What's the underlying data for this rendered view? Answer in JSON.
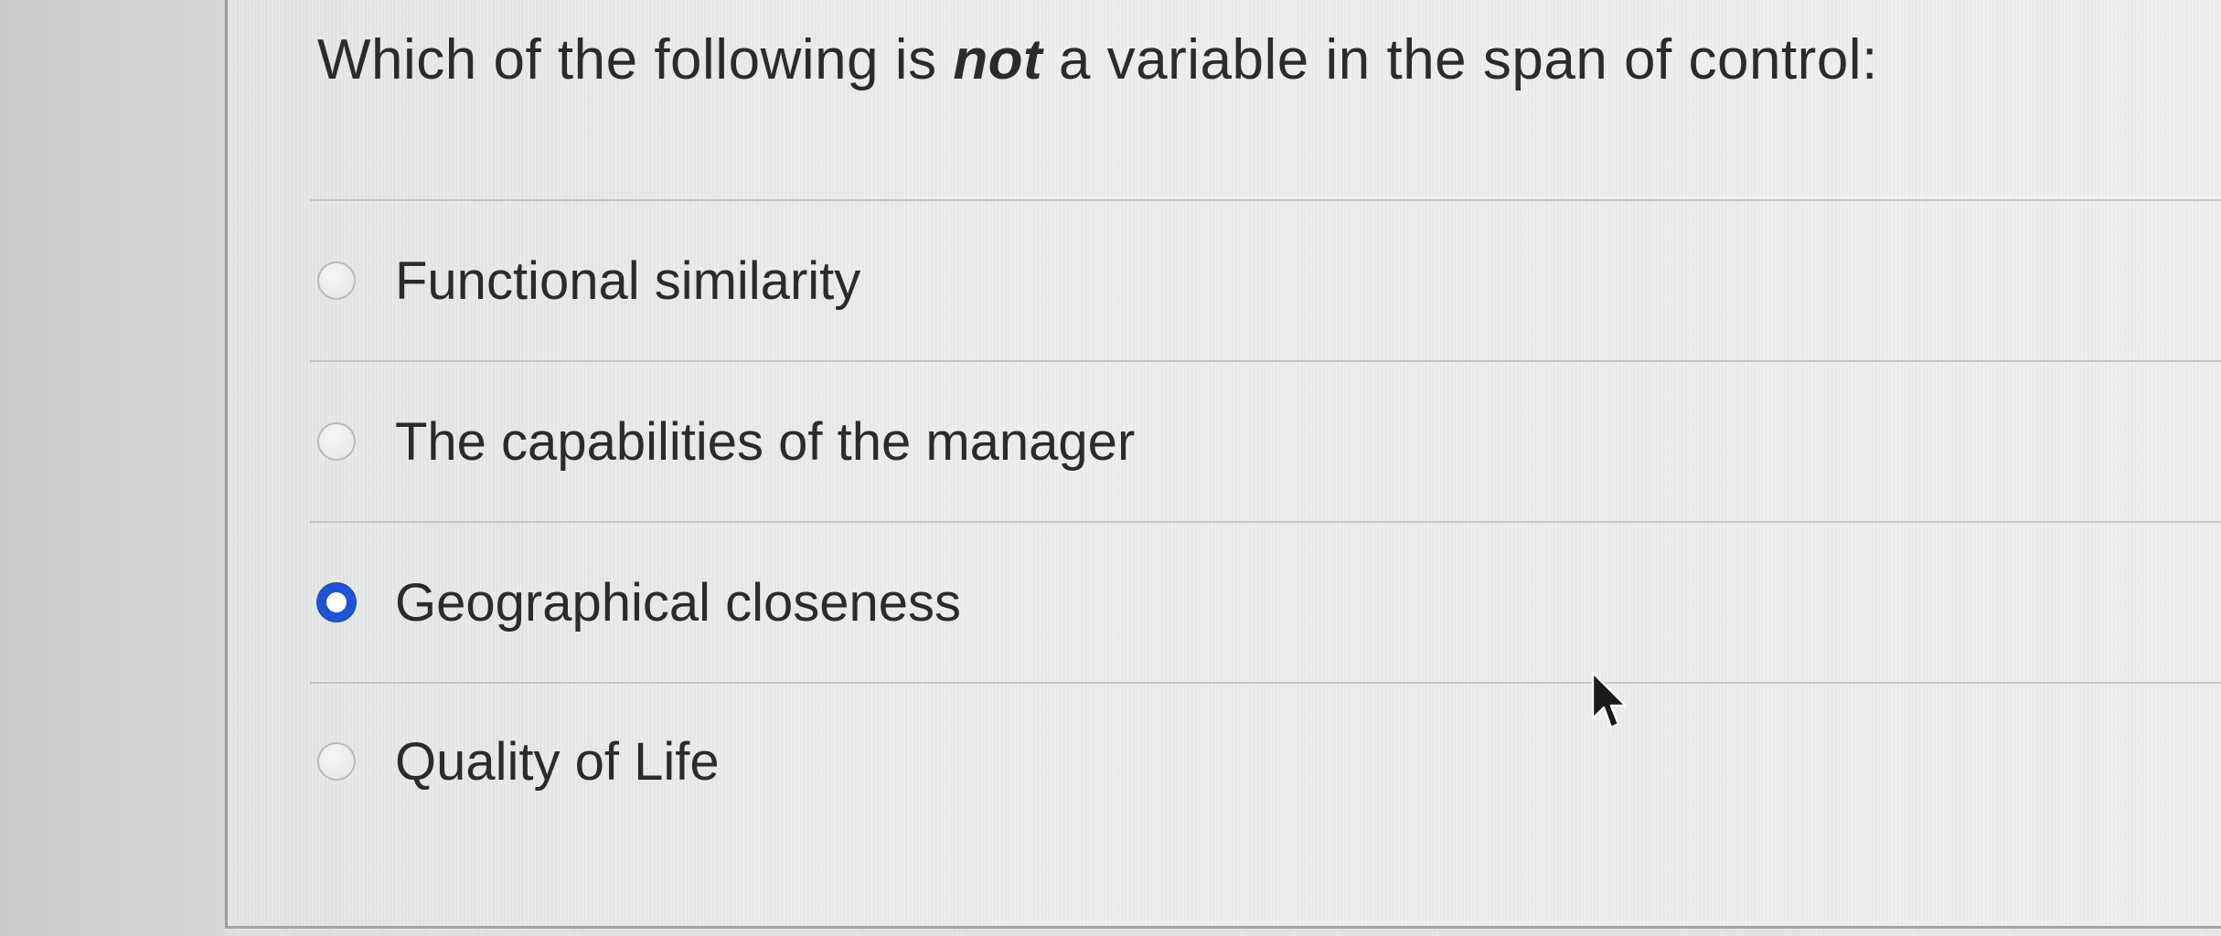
{
  "question": {
    "prefix": "Which of the following is ",
    "emphasis": "not",
    "suffix": " a variable in the span of control:"
  },
  "options": [
    {
      "label": "Functional similarity",
      "selected": false
    },
    {
      "label": "The capabilities of the manager",
      "selected": false
    },
    {
      "label": "Geographical closeness",
      "selected": true
    },
    {
      "label": "Quality of Life",
      "selected": false
    }
  ],
  "colors": {
    "selected_radio": "#1f53d6",
    "text": "#2a2b2c"
  },
  "icons": {
    "cursor": "mouse-pointer-icon"
  }
}
